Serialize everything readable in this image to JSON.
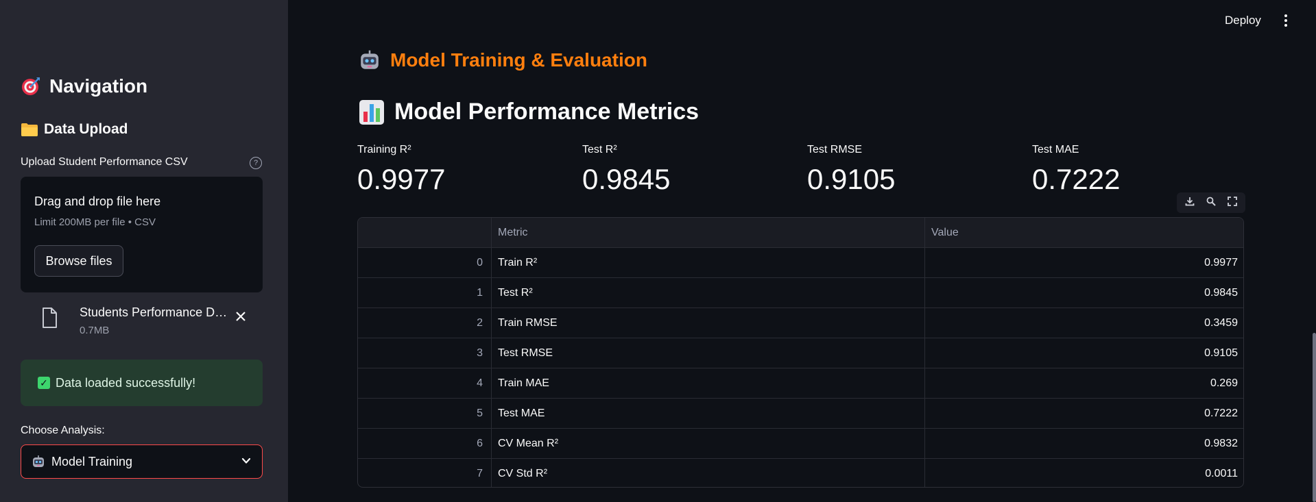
{
  "sidebar": {
    "nav_title": "Navigation",
    "section_title": "Data Upload",
    "upload_label": "Upload Student Performance CSV",
    "dropzone": {
      "title": "Drag and drop file here",
      "subtitle": "Limit 200MB per file • CSV",
      "browse_label": "Browse files"
    },
    "file": {
      "name": "Students Performance Dataset.csv",
      "size": "0.7MB"
    },
    "success_message": "Data loaded successfully!",
    "choose_label": "Choose Analysis:",
    "selected_analysis": "Model Training"
  },
  "header": {
    "deploy_label": "Deploy"
  },
  "main": {
    "page_title": "Model Training & Evaluation",
    "metrics_title": "Model Performance Metrics",
    "metrics": [
      {
        "label": "Training R²",
        "value": "0.9977"
      },
      {
        "label": "Test R²",
        "value": "0.9845"
      },
      {
        "label": "Test RMSE",
        "value": "0.9105"
      },
      {
        "label": "Test MAE",
        "value": "0.7222"
      }
    ],
    "table": {
      "columns": [
        "",
        "Metric",
        "Value"
      ],
      "rows": [
        [
          "0",
          "Train R²",
          "0.9977"
        ],
        [
          "1",
          "Test R²",
          "0.9845"
        ],
        [
          "2",
          "Train RMSE",
          "0.3459"
        ],
        [
          "3",
          "Test RMSE",
          "0.9105"
        ],
        [
          "4",
          "Train MAE",
          "0.269"
        ],
        [
          "5",
          "Test MAE",
          "0.7222"
        ],
        [
          "6",
          "CV Mean R²",
          "0.9832"
        ],
        [
          "7",
          "CV Std R²",
          "0.0011"
        ]
      ]
    }
  },
  "icons": {
    "nav": "target-icon",
    "upload": "folder-icon",
    "file": "document-icon",
    "close": "close-icon",
    "success": "check-icon",
    "robot": "robot-icon",
    "chart": "bar-chart-icon",
    "download": "download-icon",
    "search": "search-icon",
    "fullscreen": "fullscreen-icon",
    "menu": "kebab-menu-icon"
  },
  "colors": {
    "accent": "#ff4b4b",
    "heading_orange": "#ff7f0e",
    "success_bg": "#243d2f",
    "background": "#0e1117",
    "sidebar_bg": "#262730"
  }
}
